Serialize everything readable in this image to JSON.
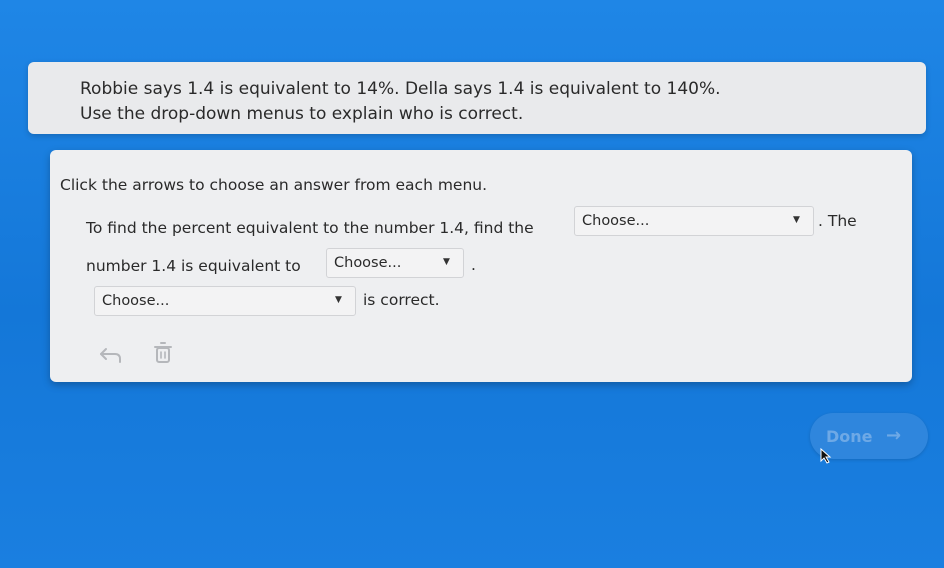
{
  "question": {
    "line1": "Robbie says 1.4 is equivalent to 14%. Della says 1.4 is equivalent to 140%.",
    "line2": "Use the drop-down menus to explain who is correct."
  },
  "instructions": "Click the arrows to choose an answer from each menu.",
  "sentence": {
    "part1": "To find the percent equivalent to the number 1.4, find the",
    "part2": ". The",
    "part3": "number 1.4 is equivalent to",
    "part4": ".",
    "part5": "is correct."
  },
  "dropdowns": {
    "first": "Choose...",
    "second": "Choose...",
    "third": "Choose..."
  },
  "icons": {
    "undo": "undo-arrow-icon",
    "delete": "trash-icon",
    "dropdown": "caret-down-icon",
    "done": "arrow-right-icon"
  },
  "done_button": {
    "label": "Done"
  },
  "colors": {
    "background": "#1a7fe0",
    "card": "#eeeff1",
    "done_button": "#2f86dd",
    "done_text": "#6ea9e6"
  }
}
